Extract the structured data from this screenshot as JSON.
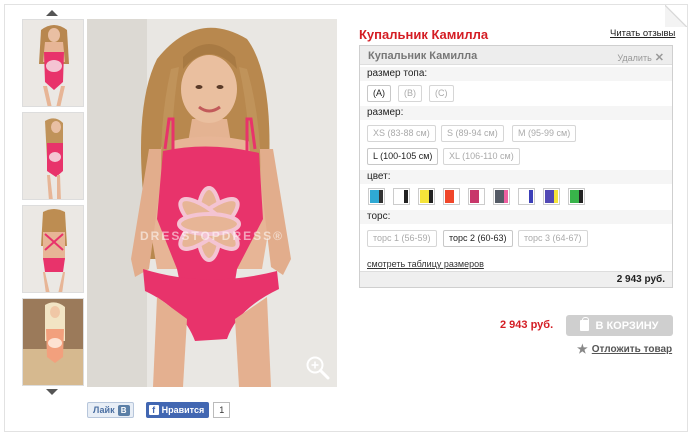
{
  "product": {
    "title": "Купальник Камилла",
    "reviews_link": "Читать отзывы",
    "watermark": "DRESSTOPDRESS®"
  },
  "thumbnails": [
    {
      "name": "front-view"
    },
    {
      "name": "side-view"
    },
    {
      "name": "back-view"
    },
    {
      "name": "beach-view"
    }
  ],
  "selector": {
    "header": "Купальник Камилла",
    "remove_label": "Удалить",
    "remove_icon": "close-icon",
    "sections": {
      "top_size": "размер топа:",
      "size": "размер:",
      "color": "цвет:",
      "torso": "торс:"
    },
    "top_sizes": [
      {
        "label": "(A)",
        "selected": true
      },
      {
        "label": "(B)",
        "selected": false
      },
      {
        "label": "(C)",
        "selected": false
      }
    ],
    "sizes": [
      {
        "label": "XS (83-88 см)",
        "selected": false
      },
      {
        "label": "S (89-94 см)",
        "selected": false
      },
      {
        "label": "M (95-99 см)",
        "selected": false
      },
      {
        "label": "L (100-105 см)",
        "selected": true
      },
      {
        "label": "XL (106-110 см)",
        "selected": false
      }
    ],
    "colors": [
      {
        "main": "#2fa9d4",
        "stripe": "#333333"
      },
      {
        "main": "#ffffff",
        "stripe": "#222222"
      },
      {
        "main": "#f5e43a",
        "stripe": "#222222"
      },
      {
        "main": "#f0462a",
        "stripe": "#ffffff"
      },
      {
        "main": "#c8376a",
        "stripe": "#ffffff"
      },
      {
        "main": "#555b66",
        "stripe": "#ef5fa0"
      },
      {
        "main": "#ffffff",
        "stripe": "#3c3fb8"
      },
      {
        "main": "#5249b5",
        "stripe": "#f5e43a"
      },
      {
        "main": "#38b44a",
        "stripe": "#222222"
      }
    ],
    "torso": [
      {
        "label": "торс 1 (56-59)",
        "selected": false
      },
      {
        "label": "торс 2 (60-63)",
        "selected": true
      },
      {
        "label": "торс 3 (64-67)",
        "selected": false
      }
    ],
    "size_chart_link": "смотреть таблицу размеров",
    "total": "2 943 руб."
  },
  "purchase": {
    "price": "2 943 руб.",
    "cart_button": "В КОРЗИНУ",
    "cart_icon": "shopping-bag-icon",
    "defer_label": "Отложить товар",
    "defer_icon": "star-icon"
  },
  "social": {
    "vk_like": "Лайк",
    "vk_badge": "В",
    "fb_like": "Нравится",
    "fb_badge": "f",
    "fb_count": "1"
  },
  "colors": {
    "accent": "#d41d24",
    "swimsuit": "#e8336b",
    "cart_disabled": "#cfcfcf"
  }
}
